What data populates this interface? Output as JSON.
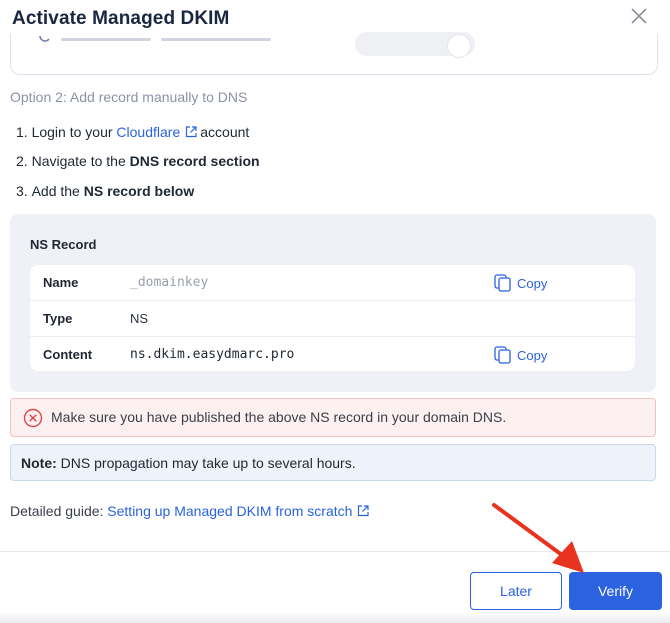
{
  "dialog": {
    "title": "Activate Managed DKIM"
  },
  "option2": {
    "heading": "Option 2: Add record manually to DNS",
    "steps": [
      {
        "num": "1.",
        "pre": "Login to your",
        "link": "Cloudflare",
        "post": "account"
      },
      {
        "num": "2.",
        "pre": "Navigate to the",
        "bold": "DNS record section"
      },
      {
        "num": "3.",
        "pre": "Add the",
        "bold": "NS record below"
      }
    ]
  },
  "ns_record": {
    "title": "NS Record",
    "rows": [
      {
        "label": "Name",
        "value": "_domainkey",
        "copy": "Copy"
      },
      {
        "label": "Type",
        "value": "NS"
      },
      {
        "label": "Content",
        "value": "ns.dkim.easydmarc.pro",
        "copy": "Copy"
      }
    ]
  },
  "alerts": {
    "error": "Make sure you have published the above NS record in your domain DNS.",
    "note_label": "Note:",
    "note_text": "DNS propagation may take up to several hours."
  },
  "guide": {
    "label": "Detailed guide:",
    "link": "Setting up Managed DKIM from scratch"
  },
  "buttons": {
    "later": "Later",
    "verify": "Verify"
  },
  "colors": {
    "accent": "#2a62e0",
    "error_border": "#f2c1c1",
    "annotation_arrow": "#e8331f"
  },
  "icons": {
    "close": "close-icon",
    "external": "external-link-icon",
    "copy": "copy-icon",
    "error": "error-circle-icon"
  }
}
